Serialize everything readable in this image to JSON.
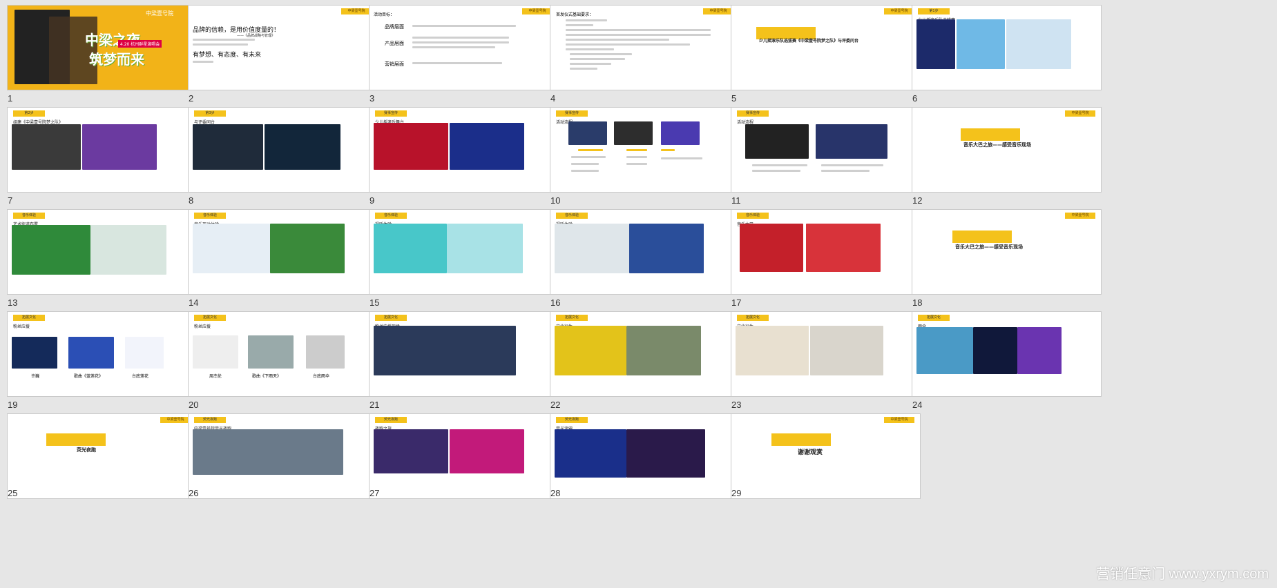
{
  "slides": {
    "s1": {
      "number": "1",
      "title_line1": "中梁之夜",
      "title_line2": "筑梦而来",
      "event": "4.20 杭州群星演唱会",
      "brand": "中梁壹号院"
    },
    "s2": {
      "number": "2",
      "heading": "品牌的信赖，是用价值度量的！",
      "sub": "——《品牌战略与管理》",
      "tag1": "有梦想、有态度、有未来"
    },
    "s3": {
      "number": "3",
      "heading": "活动目标：",
      "row1": "品牌层面",
      "row2": "产品层面",
      "row3": "营销层面"
    },
    "s4": {
      "number": "4",
      "heading": "首发仪式基础要求："
    },
    "s5": {
      "number": "5",
      "title": "少儿摇滚乐队选拔赛《中梁壹号院梦之队》与评委问台"
    },
    "s6": {
      "number": "6",
      "tag": "第1步",
      "title": "少儿摇滚乐队选拔赛"
    },
    "s7": {
      "number": "7",
      "tag": "第2步",
      "title": "组建《中梁壹号院梦之队》"
    },
    "s8": {
      "number": "8",
      "tag": "第3步",
      "title": "与评委同台"
    },
    "s9": {
      "number": "9",
      "tag": "赛事宣传",
      "title": "少儿摇滚乐舞台"
    },
    "s10": {
      "number": "10",
      "tag": "赛事宣传",
      "title": "活动流程"
    },
    "s11": {
      "number": "11",
      "tag": "赛事宣传",
      "title": "活动流程"
    },
    "s12": {
      "number": "12",
      "title": "音乐大巴之旅——感受音乐现场"
    },
    "s13": {
      "number": "13",
      "tag": "音乐体验",
      "title": "艺术街道布置"
    },
    "s14": {
      "number": "14",
      "tag": "音乐体验",
      "title": "音乐互动体验"
    },
    "s15": {
      "number": "15",
      "tag": "音乐体验",
      "title": "视听体验"
    },
    "s16": {
      "number": "16",
      "tag": "音乐体验",
      "title": "视听体验"
    },
    "s17": {
      "number": "17",
      "tag": "音乐体验",
      "title": "音乐大巴"
    },
    "s18": {
      "number": "18",
      "title": "音乐大巴之旅——感受音乐现场"
    },
    "s19": {
      "number": "19",
      "tag": "拓展文化",
      "title": "粉丝应援",
      "label1": "许巍",
      "label2": "歌曲《蓝莲花》",
      "label3": "台底莲花"
    },
    "s20": {
      "number": "20",
      "tag": "拓展文化",
      "title": "粉丝应援",
      "label1": "周杰伦",
      "label2": "歌曲《下雨天》",
      "label3": "台底雨伞"
    },
    "s21": {
      "number": "21",
      "tag": "拓展文化",
      "title": "粉丝应援现场"
    },
    "s22": {
      "number": "22",
      "tag": "拓展文化",
      "title": "文化衍生"
    },
    "s23": {
      "number": "23",
      "tag": "拓展文化",
      "title": "文化衍生"
    },
    "s24": {
      "number": "24",
      "tag": "拓展文化",
      "title": "雨伞"
    },
    "s25": {
      "number": "25",
      "title": "荧光夜跑"
    },
    "s26": {
      "number": "26",
      "tag": "荧光夜跑",
      "title": "中梁壹号院荧光夜跑"
    },
    "s27": {
      "number": "27",
      "tag": "荧光夜跑",
      "title": "夜跑之旅"
    },
    "s28": {
      "number": "28",
      "tag": "荧光夜跑",
      "title": "荧光涂鸦"
    },
    "s29": {
      "number": "29",
      "title": "谢谢观赏"
    }
  },
  "logo_text": "中梁壹号院",
  "watermark": "营销任意门 www.yxrym.com",
  "colors": {
    "accent": "#f4c21b",
    "background": "#e6e6e6"
  }
}
